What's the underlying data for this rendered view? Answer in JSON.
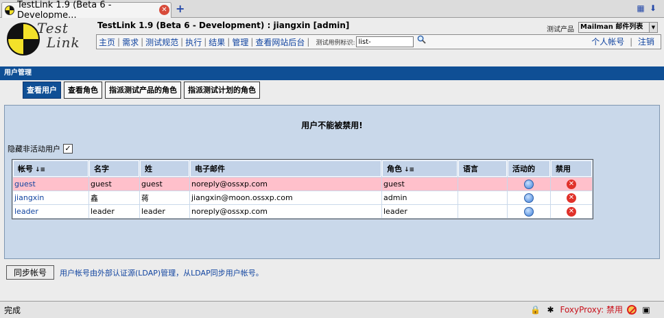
{
  "browser": {
    "tab_title": "TestLink 1.9 (Beta 6 - Developme...",
    "new_tab": "+"
  },
  "header": {
    "logo_line1": "Test",
    "logo_line2": "Link",
    "app_title": "TestLink 1.9 (Beta 6 - Development) : jiangxin [admin]",
    "product_label": "测试产品",
    "product_value": "Mailman 邮件列表",
    "menu": [
      "主页",
      "需求",
      "测试规范",
      "执行",
      "结果",
      "管理",
      "查看网站后台"
    ],
    "search_label": "测试用例标识:",
    "search_value": "list-",
    "user_links": [
      "个人帐号",
      "注销"
    ]
  },
  "section": {
    "title": "用户管理"
  },
  "subtabs": [
    {
      "label": "查看用户",
      "active": true
    },
    {
      "label": "查看角色",
      "active": false
    },
    {
      "label": "指派测试产品的角色",
      "active": false
    },
    {
      "label": "指派测试计划的角色",
      "active": false
    }
  ],
  "panel": {
    "message": "用户不能被禁用!",
    "hide_inactive_label": "隐藏非活动用户",
    "hide_inactive_checked": true
  },
  "table": {
    "headers": [
      "帐号",
      "名字",
      "姓",
      "电子邮件",
      "角色",
      "语言",
      "活动的",
      "禁用"
    ],
    "rows": [
      {
        "login": "guest",
        "first": "guest",
        "last": "guest",
        "email": "noreply@ossxp.com",
        "role": "guest",
        "locale": "",
        "highlight": true
      },
      {
        "login": "jiangxin",
        "first": "鑫",
        "last": "蒋",
        "email": "jiangxin@moon.ossxp.com",
        "role": "admin",
        "locale": "",
        "highlight": false
      },
      {
        "login": "leader",
        "first": "leader",
        "last": "leader",
        "email": "noreply@ossxp.com",
        "role": "leader",
        "locale": "",
        "highlight": false
      }
    ]
  },
  "sync": {
    "button_label": "同步帐号",
    "note": "用户帐号由外部认证源(LDAP)管理，从LDAP同步用户帐号。"
  },
  "statusbar": {
    "text": "完成",
    "foxyproxy": "FoxyProxy: 禁用"
  },
  "colors": {
    "section_blue": "#0f4f95",
    "panel_bg": "#c9d8ea",
    "highlight_row": "#ffc0cb",
    "link_blue": "#1144a0"
  }
}
